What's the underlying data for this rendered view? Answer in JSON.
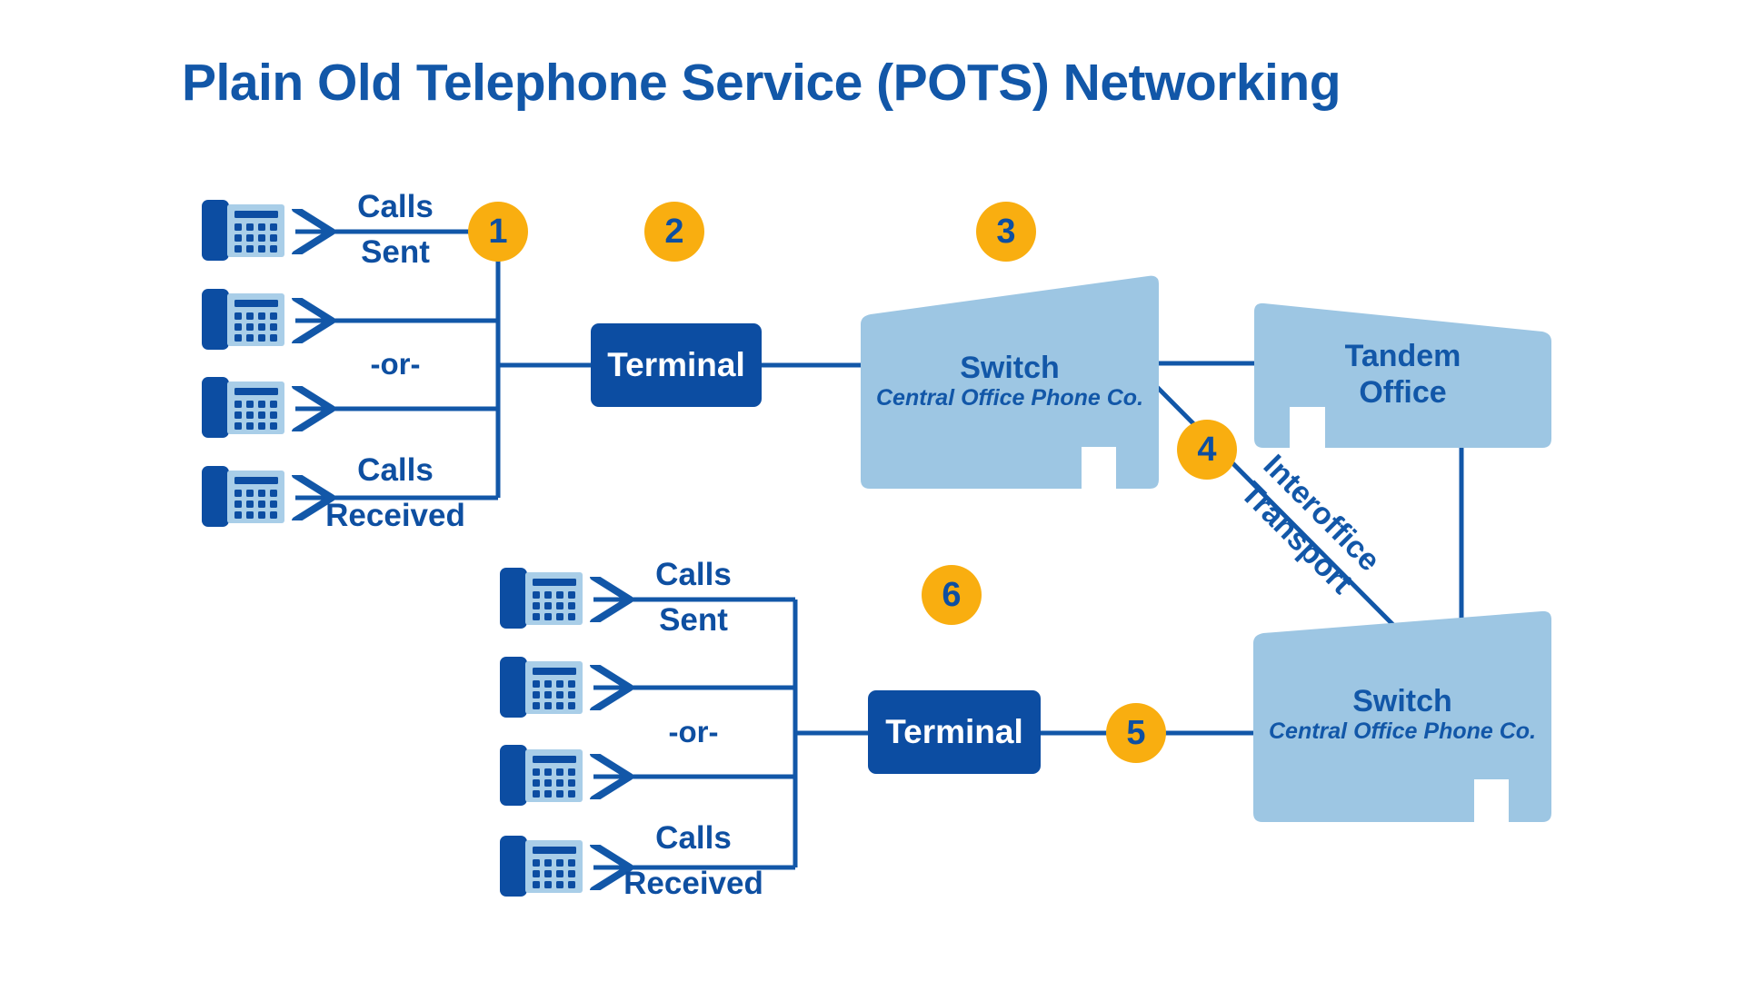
{
  "page": {
    "title": "Plain Old Telephone Service (POTS) Networking",
    "background": "#FFFFFF"
  },
  "colors": {
    "title_blue": "#1257A8",
    "dark_blue": "#0C4DA2",
    "line_blue": "#1257A8",
    "light_blue": "#9DC6E3",
    "badge_orange": "#F9AE10",
    "badge_text": "#0E4FA1",
    "white": "#FFFFFF"
  },
  "badges": [
    {
      "id": "badge-1",
      "label": "1"
    },
    {
      "id": "badge-2",
      "label": "2"
    },
    {
      "id": "badge-3",
      "label": "3"
    },
    {
      "id": "badge-4",
      "label": "4"
    },
    {
      "id": "badge-5",
      "label": "5"
    },
    {
      "id": "badge-6",
      "label": "6"
    }
  ],
  "top_group": {
    "calls_sent": "Calls\nSent",
    "calls_sent_line1": "Calls",
    "calls_sent_line2": "Sent",
    "or": "-or-",
    "calls_received_line1": "Calls",
    "calls_received_line2": "Received",
    "terminal": "Terminal",
    "phones": [
      {
        "name": "phone-1",
        "icon": "desk-phone-icon"
      },
      {
        "name": "phone-2",
        "icon": "desk-phone-icon"
      },
      {
        "name": "phone-3",
        "icon": "desk-phone-icon"
      },
      {
        "name": "phone-4",
        "icon": "desk-phone-icon"
      }
    ]
  },
  "bottom_group": {
    "calls_sent_line1": "Calls",
    "calls_sent_line2": "Sent",
    "or": "-or-",
    "calls_received_line1": "Calls",
    "calls_received_line2": "Received",
    "terminal": "Terminal",
    "phones": [
      {
        "name": "phone-5",
        "icon": "desk-phone-icon"
      },
      {
        "name": "phone-6",
        "icon": "desk-phone-icon"
      },
      {
        "name": "phone-7",
        "icon": "desk-phone-icon"
      },
      {
        "name": "phone-8",
        "icon": "desk-phone-icon"
      }
    ]
  },
  "buildings": {
    "switch_top": {
      "title": "Switch",
      "subtitle": "Central Office Phone Co.",
      "icon": "building-icon"
    },
    "tandem": {
      "title_line1": "Tandem",
      "title_line2": "Office",
      "icon": "building-icon"
    },
    "switch_bottom": {
      "title": "Switch",
      "subtitle": "Central Office Phone Co.",
      "icon": "building-icon"
    }
  },
  "links": {
    "interoffice_line1": "Interoffice",
    "interoffice_line2": "Transport"
  }
}
